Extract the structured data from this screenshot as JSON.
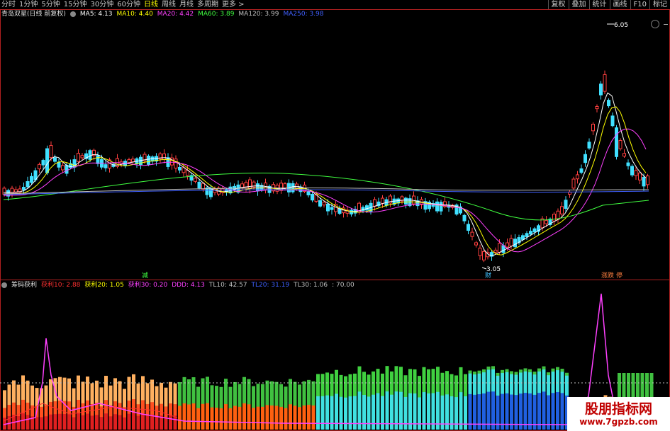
{
  "topbar": {
    "tabs": [
      "分时",
      "1分钟",
      "5分钟",
      "15分钟",
      "30分钟",
      "60分钟",
      "日线",
      "周线",
      "月线",
      "多周期",
      "更多 >"
    ],
    "active_tab": "日线",
    "tools": [
      "复权",
      "叠加",
      "统计",
      "画线",
      "F10",
      "标记"
    ]
  },
  "main_panel": {
    "title": "青岛双星(日线 前复权)",
    "ma": [
      {
        "label": "MA5: 4.13",
        "color": "#ffffff"
      },
      {
        "label": "MA10: 4.40",
        "color": "#ffff00"
      },
      {
        "label": "MA20: 4.42",
        "color": "#ff40ff"
      },
      {
        "label": "MA60: 3.89",
        "color": "#40ff40"
      },
      {
        "label": "MA120: 3.99",
        "color": "#c0c0c0"
      },
      {
        "label": "MA250: 3.98",
        "color": "#4060ff"
      }
    ],
    "high_label": "6.05",
    "low_label": "3.05",
    "markers": [
      {
        "text": "减",
        "color": "#40ff40"
      },
      {
        "text": "财",
        "color": "#40c0ff"
      },
      {
        "text": "涨跌",
        "color": "#ff8040"
      },
      {
        "text": "停",
        "color": "#ff8040"
      }
    ]
  },
  "sub_panel": {
    "title": "筹码获利",
    "items": [
      {
        "label": "获利10: 2.88",
        "color": "#ff3030"
      },
      {
        "label": "获利20: 1.05",
        "color": "#ffff00"
      },
      {
        "label": "获利30: 0.20",
        "color": "#ff40ff"
      },
      {
        "label": "DDD: 4.13",
        "color": "#ff40ff"
      },
      {
        "label": "TL10: 42.57",
        "color": "#c0c0c0"
      },
      {
        "label": "TL20: 31.19",
        "color": "#4060ff"
      },
      {
        "label": "TL30: 1.06",
        "color": "#c0c0c0"
      },
      {
        "label": ": 70.00",
        "color": "#c0c0c0"
      }
    ]
  },
  "watermark": {
    "line1": "股朋指标网",
    "line2": "www.7gpzb.com"
  }
}
